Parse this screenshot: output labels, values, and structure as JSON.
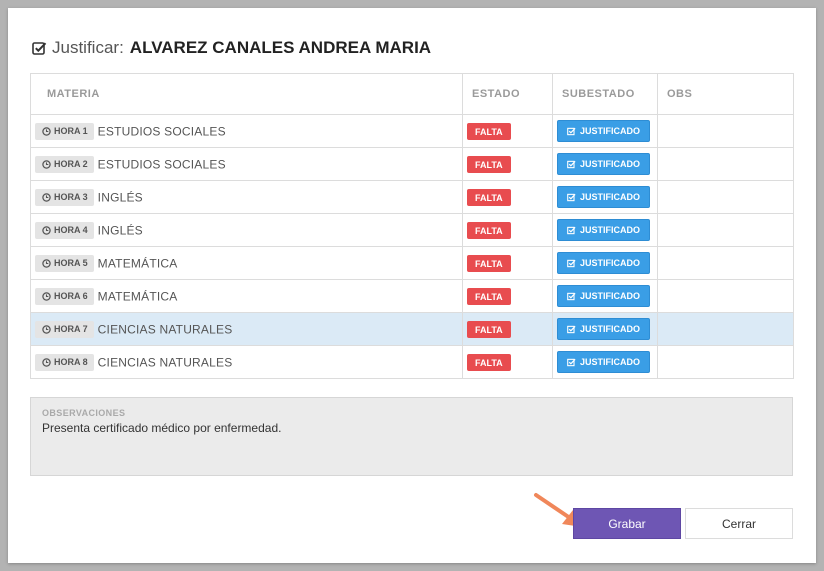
{
  "dialog": {
    "title_label": "Justificar:",
    "student_name": "ALVAREZ CANALES ANDREA MARIA"
  },
  "table": {
    "headers": {
      "materia": "MATERIA",
      "estado": "ESTADO",
      "subestado": "SUBESTADO",
      "obs": "OBS"
    },
    "rows": [
      {
        "hora": "HORA 1",
        "materia": "ESTUDIOS SOCIALES",
        "estado": "FALTA",
        "subestado": "JUSTIFICADO",
        "obs": ""
      },
      {
        "hora": "HORA 2",
        "materia": "ESTUDIOS SOCIALES",
        "estado": "FALTA",
        "subestado": "JUSTIFICADO",
        "obs": ""
      },
      {
        "hora": "HORA 3",
        "materia": "INGLÉS",
        "estado": "FALTA",
        "subestado": "JUSTIFICADO",
        "obs": ""
      },
      {
        "hora": "HORA 4",
        "materia": "INGLÉS",
        "estado": "FALTA",
        "subestado": "JUSTIFICADO",
        "obs": ""
      },
      {
        "hora": "HORA 5",
        "materia": "MATEMÁTICA",
        "estado": "FALTA",
        "subestado": "JUSTIFICADO",
        "obs": ""
      },
      {
        "hora": "HORA 6",
        "materia": "MATEMÁTICA",
        "estado": "FALTA",
        "subestado": "JUSTIFICADO",
        "obs": ""
      },
      {
        "hora": "HORA 7",
        "materia": "CIENCIAS NATURALES",
        "estado": "FALTA",
        "subestado": "JUSTIFICADO",
        "obs": "",
        "highlighted": true
      },
      {
        "hora": "HORA 8",
        "materia": "CIENCIAS NATURALES",
        "estado": "FALTA",
        "subestado": "JUSTIFICADO",
        "obs": ""
      }
    ]
  },
  "observaciones": {
    "label": "OBSERVACIONES",
    "value": "Presenta certificado médico por enfermedad."
  },
  "buttons": {
    "save_label": "Grabar",
    "close_label": "Cerrar"
  },
  "colors": {
    "falta_badge": "#e84c4f",
    "justificado_button": "#3a9ee6",
    "save_button": "#6e56b4",
    "highlight_row": "#dbeaf6",
    "annotation_arrow": "#f0875a"
  },
  "icons": {
    "title": "check-square-icon",
    "hora": "clock-icon",
    "justificado": "check-square-icon",
    "annotation": "pointer-arrow-icon"
  }
}
